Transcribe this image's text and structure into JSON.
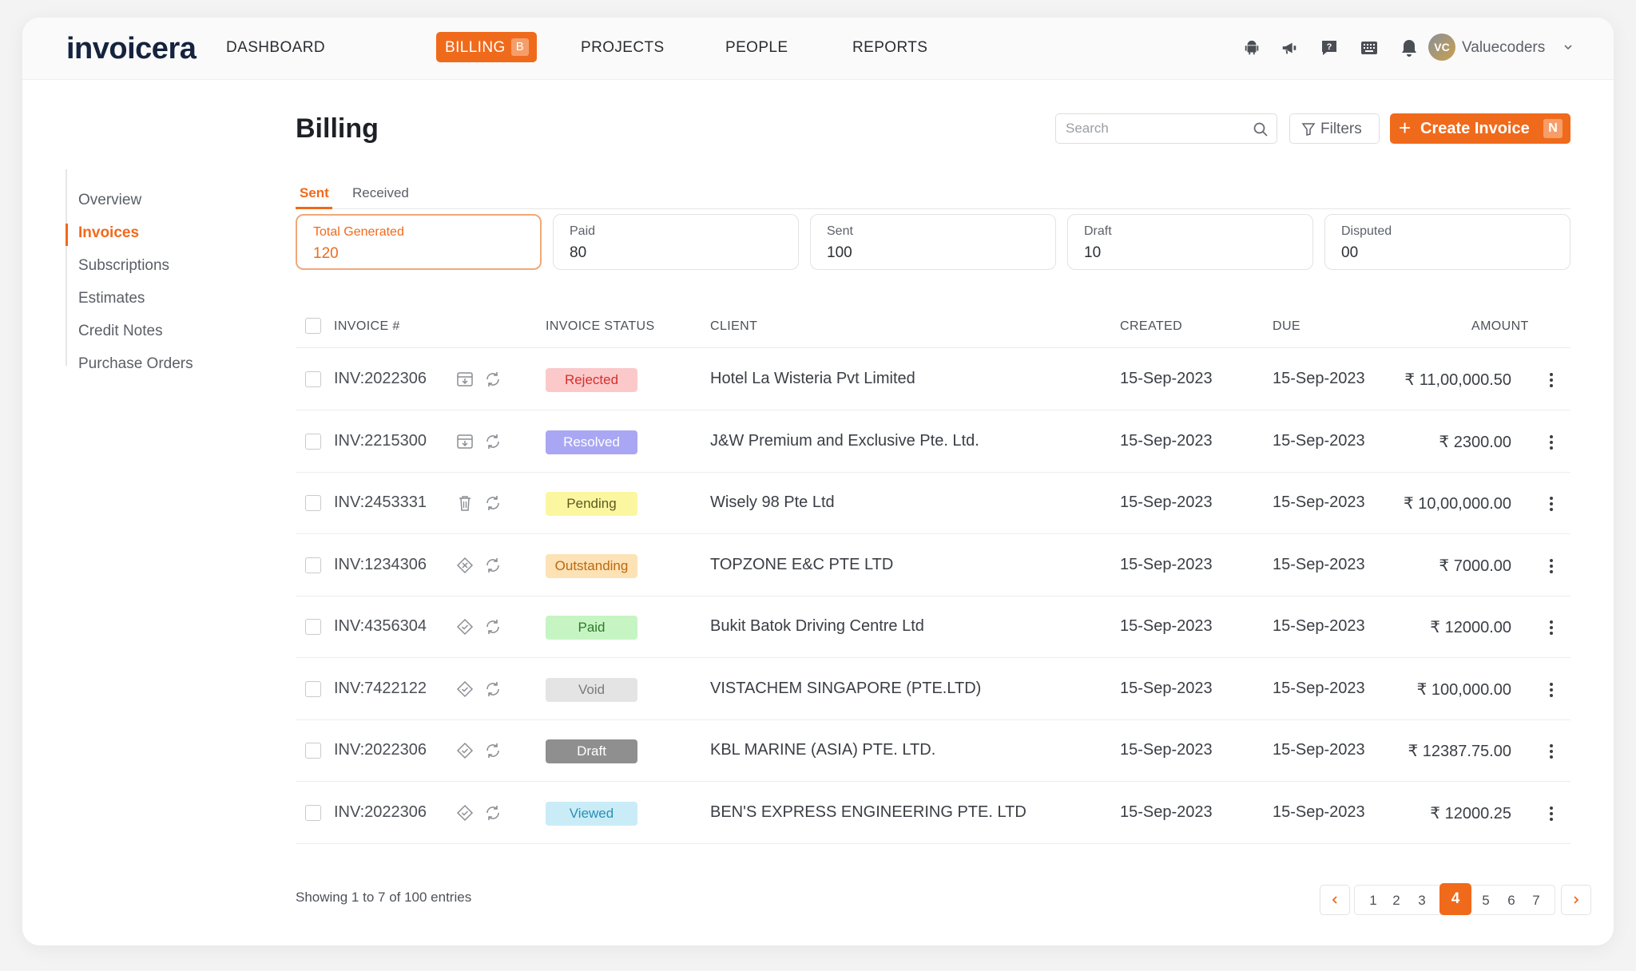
{
  "brand": {
    "logo": "invoicera",
    "accent": "#f06a1b"
  },
  "nav": {
    "items": [
      "DASHBOARD",
      "PROJECTS",
      "PEOPLE",
      "REPORTS"
    ],
    "active": "BILLING",
    "active_shortcut": "B"
  },
  "top_icons": [
    "android-icon",
    "megaphone-icon",
    "help-chat-icon",
    "keyboard-icon",
    "bell-icon"
  ],
  "user": {
    "initials": "VC",
    "name": "Valuecoders"
  },
  "sidebar": {
    "items": [
      {
        "label": "Overview"
      },
      {
        "label": "Invoices",
        "active": true
      },
      {
        "label": "Subscriptions"
      },
      {
        "label": "Estimates"
      },
      {
        "label": "Credit Notes"
      },
      {
        "label": "Purchase Orders"
      }
    ]
  },
  "page": {
    "title": "Billing",
    "search_placeholder": "Search",
    "filters_label": "Filters",
    "create_label": "Create Invoice",
    "create_shortcut": "N"
  },
  "tabs": [
    {
      "label": "Sent",
      "active": true
    },
    {
      "label": "Received"
    }
  ],
  "stats": [
    {
      "label": "Total Generated",
      "value": "120",
      "active": true
    },
    {
      "label": "Paid",
      "value": "80"
    },
    {
      "label": "Sent",
      "value": "100"
    },
    {
      "label": "Draft",
      "value": "10"
    },
    {
      "label": "Disputed",
      "value": "00"
    }
  ],
  "table": {
    "headers": {
      "invoice": "INVOICE #",
      "status": "INVOICE STATUS",
      "client": "CLIENT",
      "created": "CREATED",
      "due": "DUE",
      "amount": "AMOUNT"
    },
    "rows": [
      {
        "invoice": "INV:2022306",
        "action_icon": "download-icon",
        "status": "Rejected",
        "client": "Hotel La Wisteria Pvt Limited",
        "created": "15-Sep-2023",
        "due": "15-Sep-2023",
        "amount": "₹ 11,00,000.50"
      },
      {
        "invoice": "INV:2215300",
        "action_icon": "download-icon",
        "status": "Resolved",
        "client": "J&W Premium and Exclusive Pte. Ltd.",
        "created": "15-Sep-2023",
        "due": "15-Sep-2023",
        "amount": "₹ 2300.00"
      },
      {
        "invoice": "INV:2453331",
        "action_icon": "trash-icon",
        "status": "Pending",
        "client": "Wisely 98 Pte Ltd",
        "created": "15-Sep-2023",
        "due": "15-Sep-2023",
        "amount": "₹ 10,00,000.00"
      },
      {
        "invoice": "INV:1234306",
        "action_icon": "cancel-diamond-icon",
        "status": "Outstanding",
        "client": "TOPZONE E&C PTE LTD",
        "created": "15-Sep-2023",
        "due": "15-Sep-2023",
        "amount": "₹ 7000.00"
      },
      {
        "invoice": "INV:4356304",
        "action_icon": "check-diamond-icon",
        "status": "Paid",
        "client": "Bukit Batok Driving Centre Ltd",
        "created": "15-Sep-2023",
        "due": "15-Sep-2023",
        "amount": "₹ 12000.00"
      },
      {
        "invoice": "INV:7422122",
        "action_icon": "check-diamond-icon",
        "status": "Void",
        "client": "VISTACHEM SINGAPORE (PTE.LTD)",
        "created": "15-Sep-2023",
        "due": "15-Sep-2023",
        "amount": "₹ 100,000.00"
      },
      {
        "invoice": "INV:2022306",
        "action_icon": "check-diamond-icon",
        "status": "Draft",
        "client": "KBL MARINE (ASIA) PTE. LTD.",
        "created": "15-Sep-2023",
        "due": "15-Sep-2023",
        "amount": "₹ 12387.75.00"
      },
      {
        "invoice": "INV:2022306",
        "action_icon": "check-diamond-icon",
        "status": "Viewed",
        "client": "BEN'S EXPRESS ENGINEERING PTE. LTD",
        "created": "15-Sep-2023",
        "due": "15-Sep-2023",
        "amount": "₹ 12000.25"
      }
    ]
  },
  "status_colors": {
    "Rejected": {
      "bg": "#fbc9c9",
      "fg": "#d42f2f"
    },
    "Resolved": {
      "bg": "#a9a6f4",
      "fg": "#ffffff"
    },
    "Pending": {
      "bg": "#fbf7a0",
      "fg": "#5c5a20"
    },
    "Outstanding": {
      "bg": "#fde2b5",
      "fg": "#b86a12"
    },
    "Paid": {
      "bg": "#c6f5c3",
      "fg": "#2d7b2a"
    },
    "Void": {
      "bg": "#e4e4e4",
      "fg": "#7a7a7a"
    },
    "Draft": {
      "bg": "#8f8f8f",
      "fg": "#ffffff"
    },
    "Viewed": {
      "bg": "#c9ecf7",
      "fg": "#2b8fb5"
    }
  },
  "pagination": {
    "summary": "Showing 1 to 7 of 100 entries",
    "pages": [
      "1",
      "2",
      "3",
      "4",
      "5",
      "6",
      "7"
    ],
    "current": "4"
  }
}
